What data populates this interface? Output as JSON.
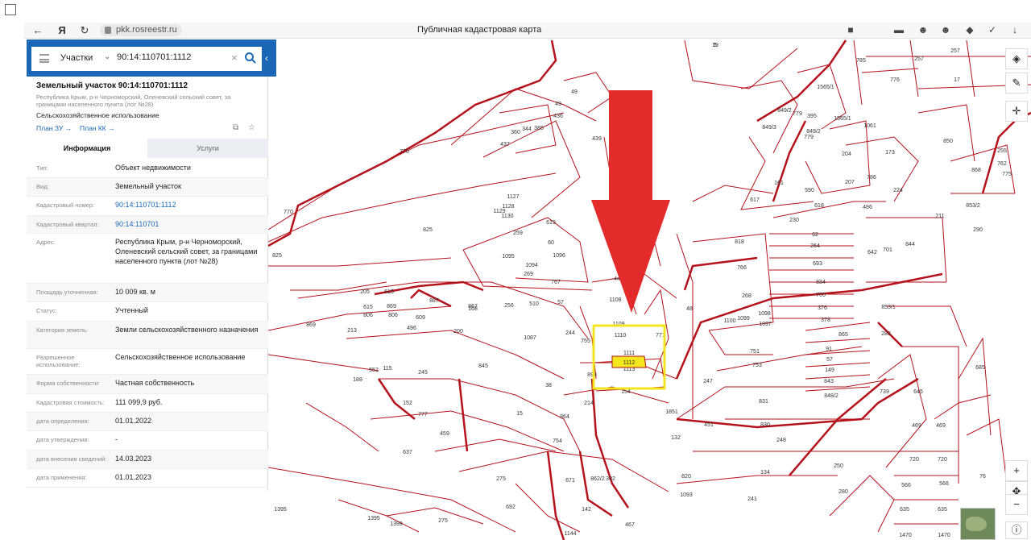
{
  "browser": {
    "url": "pkk.rosreestr.ru",
    "page_title": "Публичная кадастровая карта"
  },
  "search": {
    "mode": "Участки",
    "query": "90:14:110701:1112"
  },
  "parcel": {
    "title": "Земельный участок 90:14:110701:1112",
    "address_short": "Республика Крым, р-н Черноморский, Оленевский сельский совет, за границами населенного пункта (лот №28)",
    "purpose": "Сельскохозяйственное использование",
    "plan_zu": "План ЗУ →",
    "plan_kk": "План КК →"
  },
  "tabs": {
    "info": "Информация",
    "services": "Услуги"
  },
  "info_rows": [
    {
      "key": "Тип:",
      "value": "Объект недвижимости"
    },
    {
      "key": "Вид:",
      "value": "Земельный участок"
    },
    {
      "key": "Кадастровый номер:",
      "value": "90:14:110701:1112"
    },
    {
      "key": "Кадастровый квартал:",
      "value": "90:14:110701"
    },
    {
      "key": "Адрес:",
      "value": "Республика Крым, р-н Черноморский, Оленевский сельский совет, за границами населенного пункта (лот №28)"
    },
    {
      "key": "Площадь уточненная:",
      "value": "10 009 кв. м"
    },
    {
      "key": "Статус:",
      "value": "Учтенный"
    },
    {
      "key": "Категория земель:",
      "value": "Земли сельскохозяйственного назначения"
    },
    {
      "key": "Разрешенное использование:",
      "value": "Сельскохозяйственное использование"
    },
    {
      "key": "Форма собственности:",
      "value": "Частная собственность"
    },
    {
      "key": "Кадастровая стоимость:",
      "value": "111 099,9 руб."
    },
    {
      "key": "дата определения:",
      "value": "01.01.2022"
    },
    {
      "key": "дата утверждения:",
      "value": "-"
    },
    {
      "key": "дата внесения сведений:",
      "value": "14.03.2023"
    },
    {
      "key": "дата применения:",
      "value": "01.01.2023"
    }
  ],
  "map": {
    "selected_parcel": "1112",
    "parcel_labels": [
      "5",
      "785",
      "257",
      "257",
      "776",
      "17",
      "1565/1",
      "1565/1",
      "849/2",
      "779",
      "395",
      "849/3",
      "849/2",
      "779",
      "1061",
      "173",
      "850",
      "255",
      "762",
      "868",
      "775",
      "204",
      "786",
      "207",
      "224",
      "853/2",
      "161",
      "590",
      "617",
      "618",
      "486",
      "211",
      "230",
      "62",
      "264",
      "818",
      "766",
      "693",
      "834",
      "700",
      "376",
      "378",
      "268",
      "1100",
      "1099",
      "1098",
      "1097",
      "642",
      "701",
      "844",
      "290",
      "853/1",
      "283",
      "865",
      "91",
      "57",
      "149",
      "843",
      "848/2",
      "751",
      "753",
      "247",
      "831",
      "830",
      "451",
      "248",
      "739",
      "645",
      "685",
      "469",
      "469",
      "720",
      "720",
      "566",
      "566",
      "635",
      "635",
      "1470",
      "1470",
      "76",
      "280",
      "250",
      "134",
      "241",
      "820",
      "1093",
      "1851",
      "132",
      "154",
      "1113",
      "1111",
      "1110",
      "1109",
      "1108",
      "44",
      "771",
      "48",
      "49",
      "49",
      "436",
      "385",
      "344",
      "360",
      "437",
      "439",
      "770",
      "770",
      "825",
      "825",
      "1127",
      "1128",
      "1129",
      "1130",
      "259",
      "619",
      "60",
      "1095",
      "1096",
      "1094",
      "269",
      "767",
      "57",
      "510",
      "256",
      "168",
      "867",
      "887",
      "205",
      "615",
      "615",
      "806",
      "869",
      "806",
      "869",
      "213",
      "188",
      "552",
      "115",
      "496",
      "609",
      "200",
      "245",
      "845",
      "1087",
      "244",
      "755",
      "898",
      "38",
      "214",
      "15",
      "864",
      "754",
      "152",
      "777",
      "459",
      "637",
      "1395",
      "1395",
      "1399",
      "275",
      "275",
      "692",
      "671",
      "862/2",
      "302",
      "142",
      "467",
      "1144",
      "19"
    ],
    "arrow_color": "#e32b2b",
    "highlight_color": "#f3e61c",
    "boundary_color": "#b5121b"
  }
}
